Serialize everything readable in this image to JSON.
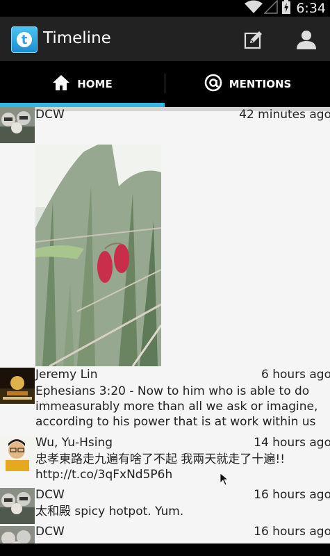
{
  "status_bar": {
    "time": "6:34",
    "icons": [
      "wifi-icon",
      "signal-icon",
      "battery-charging-icon"
    ]
  },
  "action_bar": {
    "title": "Timeline",
    "app_icon": "twitter-bird-icon",
    "actions": [
      "compose-icon",
      "profile-icon"
    ]
  },
  "tabs": [
    {
      "label": "HOME",
      "icon": "home-icon",
      "selected": true
    },
    {
      "label": "MENTIONS",
      "icon": "at-icon",
      "selected": false
    }
  ],
  "colors": {
    "accent": "#33b5e5",
    "background": "#f5f5f5",
    "action_bar": "#222222"
  },
  "tweets": [
    {
      "name": "DCW",
      "time": "42 minutes ago",
      "text": "",
      "has_photo": true
    },
    {
      "name": "Jeremy Lin",
      "time": "6 hours ago",
      "text": "Ephesians 3:20 - Now to him who is able to do immeasurably more than all we ask or imagine, according to his power that is at work within us"
    },
    {
      "name": "Wu, Yu-Hsing",
      "time": "14 hours ago",
      "text": "忠孝東路走九遍有啥了不起 我兩天就走了十遍!! http://t.co/3qFxNd5P6h"
    },
    {
      "name": "DCW",
      "time": "16 hours ago",
      "text": "太和殿 spicy hotpot. Yum."
    },
    {
      "name": "DCW",
      "time": "16 hours ago",
      "text": ""
    }
  ]
}
